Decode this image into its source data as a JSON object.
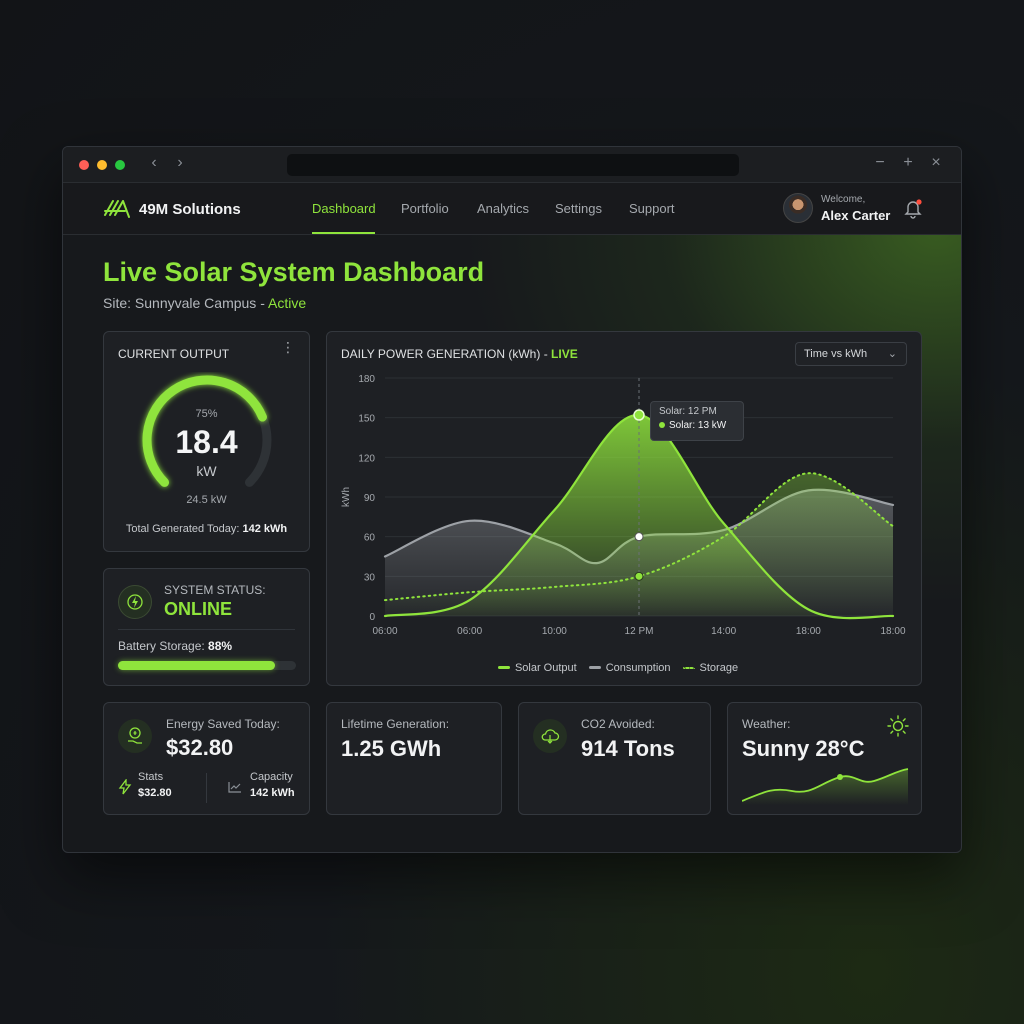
{
  "brand": {
    "name": "49M Solutions"
  },
  "nav": {
    "items": [
      {
        "label": "Dashboard",
        "active": true
      },
      {
        "label": "Portfolio"
      },
      {
        "label": "Analytics"
      },
      {
        "label": "Settings"
      },
      {
        "label": "Support"
      }
    ]
  },
  "user": {
    "welcome": "Welcome,",
    "name": "Alex Carter"
  },
  "page": {
    "title": "Live Solar System Dashboard",
    "site_prefix": "Site: Sunnyvale Campus - ",
    "site_status": "Active"
  },
  "output_card": {
    "title": "CURRENT OUTPUT",
    "percent_text": "75%",
    "percent": 0.75,
    "value": "18.4",
    "unit": "kW",
    "max": "24.5 kW",
    "total_label": "Total Generated Today: ",
    "total_value": "142 kWh"
  },
  "status_card": {
    "label": "SYSTEM STATUS:",
    "status": "ONLINE",
    "battery_label": "Battery Storage: ",
    "battery_value": "88%",
    "battery_fraction": 0.88
  },
  "chart_card": {
    "title": "DAILY POWER GENERATION (kWh) - ",
    "live": "LIVE",
    "dropdown": "Time vs kWh",
    "tooltip_time": "Solar: 12 PM",
    "tooltip_value": "Solar: 13 kW"
  },
  "chart_data": {
    "type": "area",
    "x": [
      "06:00",
      "06:00",
      "10:00",
      "12 PM",
      "14:00",
      "18:00",
      "18:00"
    ],
    "ylabel": "kWh",
    "ylim": [
      0,
      180
    ],
    "yticks": [
      0,
      30,
      60,
      90,
      120,
      150,
      180
    ],
    "series": [
      {
        "name": "Solar Output",
        "color": "#8fe43c",
        "style": "solid",
        "points": [
          [
            0,
            0
          ],
          [
            1,
            12
          ],
          [
            2,
            80
          ],
          [
            3,
            152
          ],
          [
            4,
            70
          ],
          [
            5,
            5
          ],
          [
            6,
            0
          ]
        ]
      },
      {
        "name": "Consumption",
        "color": "#9da1a6",
        "style": "solid",
        "points": [
          [
            0,
            45
          ],
          [
            1,
            72
          ],
          [
            2,
            55
          ],
          [
            2.5,
            40
          ],
          [
            3,
            60
          ],
          [
            4,
            65
          ],
          [
            5,
            95
          ],
          [
            6,
            84
          ]
        ]
      },
      {
        "name": "Storage",
        "color": "#8fe43c",
        "style": "dotted",
        "points": [
          [
            0,
            12
          ],
          [
            1,
            18
          ],
          [
            2,
            22
          ],
          [
            3,
            30
          ],
          [
            4,
            60
          ],
          [
            5,
            108
          ],
          [
            6,
            68
          ]
        ]
      }
    ],
    "grid": true,
    "legend": "bottom"
  },
  "bottom": {
    "energy": {
      "label": "Energy Saved Today:",
      "value": "$32.80",
      "stats_label": "Stats",
      "stats_value": "$32.80",
      "capacity_label": "Capacity",
      "capacity_value": "142 kWh"
    },
    "lifetime": {
      "label": "Lifetime Generation:",
      "value": "1.25 GWh"
    },
    "co2": {
      "label": "CO2 Avoided:",
      "value": "914 Tons"
    },
    "weather": {
      "label": "Weather:",
      "value": "Sunny 28°C"
    }
  },
  "colors": {
    "accent": "#8fe43c",
    "background": "#17191c",
    "card": "#1e2024"
  }
}
